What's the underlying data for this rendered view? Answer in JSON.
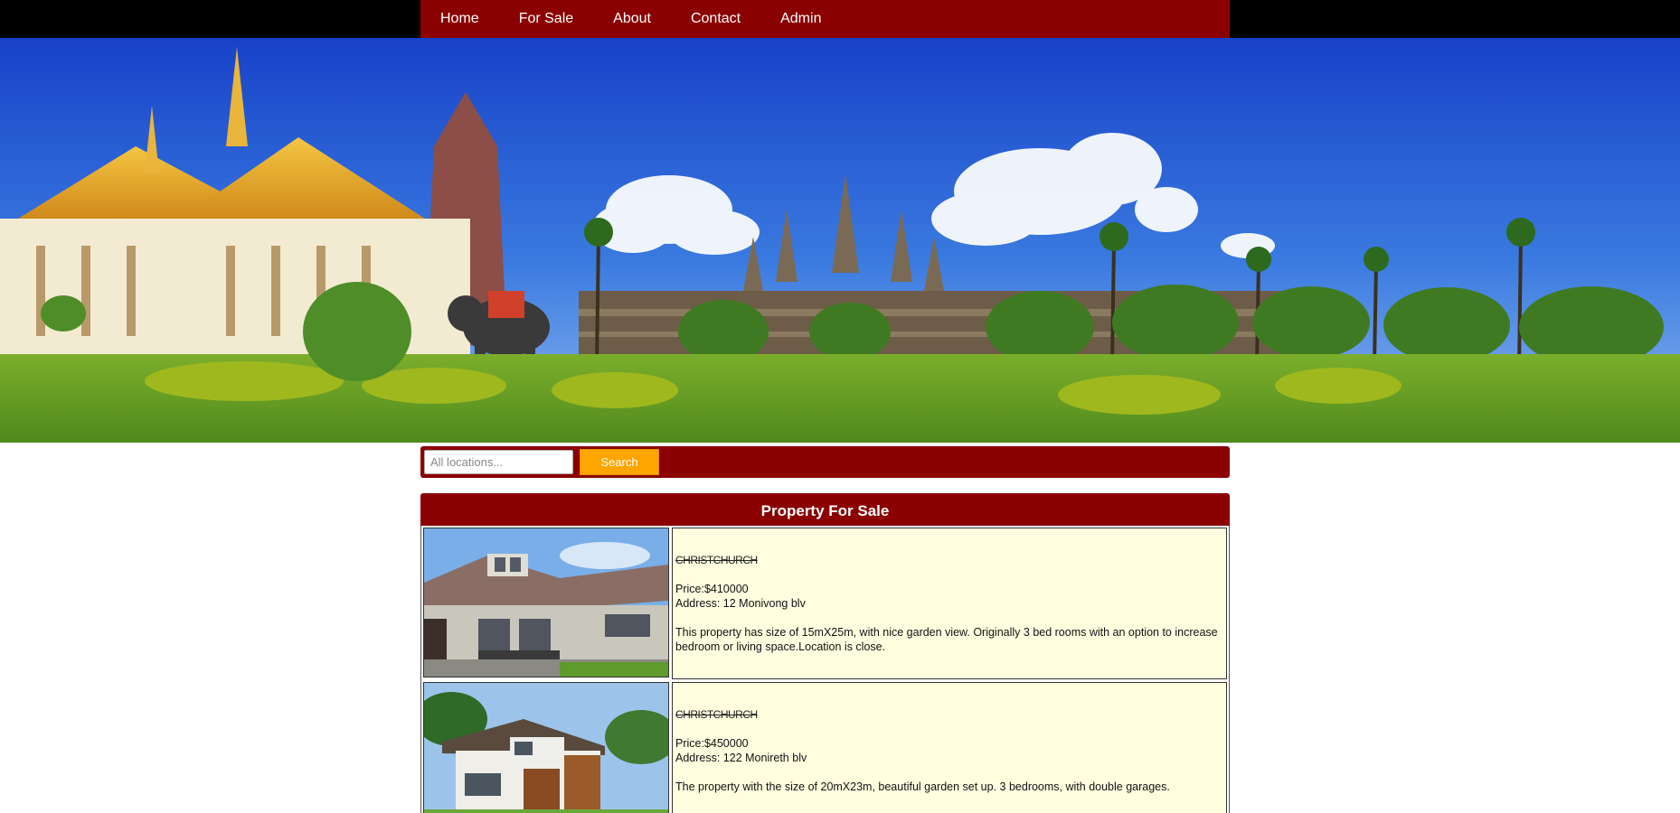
{
  "nav": {
    "items": [
      {
        "label": "Home"
      },
      {
        "label": "For Sale"
      },
      {
        "label": "About"
      },
      {
        "label": "Contact"
      },
      {
        "label": "Admin"
      }
    ]
  },
  "search": {
    "placeholder": "All locations...",
    "button_label": "Search"
  },
  "section": {
    "title": "Property For Sale"
  },
  "listings": [
    {
      "title": "CHRISTCHURCH",
      "price": "Price:$410000",
      "address": "Address: 12 Monivong blv",
      "description": "This property has size of 15mX25m, with nice garden view. Originally 3 bed rooms with an option to increase bedroom or living space.Location is close."
    },
    {
      "title": "CHRISTCHURCH",
      "price": "Price:$450000",
      "address": "Address: 122 Monireth blv",
      "description": "The property with the size of 20mX23m, beautiful garden set up. 3 bedrooms, with double garages."
    }
  ],
  "colors": {
    "nav_bg": "#8b0000",
    "accent": "#ffa500",
    "listing_bg": "#ffffe0"
  }
}
